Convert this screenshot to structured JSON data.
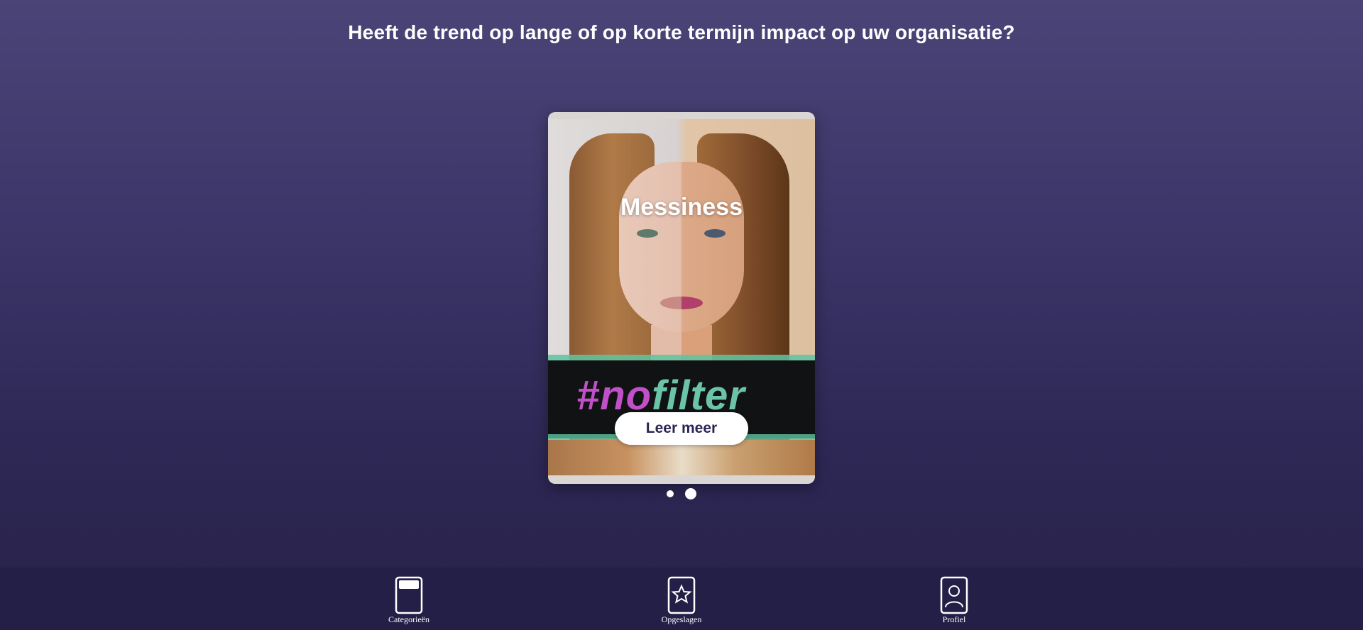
{
  "question": "Heeft de trend op lange of op korte termijn impact op uw organisatie?",
  "card": {
    "title": "Messiness",
    "image_text_hash": "#no",
    "image_text_rest": "filter",
    "button_label": "Leer meer"
  },
  "pagination": {
    "total": 2,
    "active": 2
  },
  "nav": {
    "items": [
      {
        "label": "Categorieën",
        "icon": "card-icon"
      },
      {
        "label": "Opgeslagen",
        "icon": "star-card-icon"
      },
      {
        "label": "Profiel",
        "icon": "profile-card-icon"
      }
    ]
  },
  "colors": {
    "background_top": "#4a4477",
    "background_bottom": "#272149",
    "nav_background": "#241f47",
    "button_text": "#2b2550",
    "accent_pink": "#c050c8",
    "accent_green": "#6cc4a8"
  }
}
